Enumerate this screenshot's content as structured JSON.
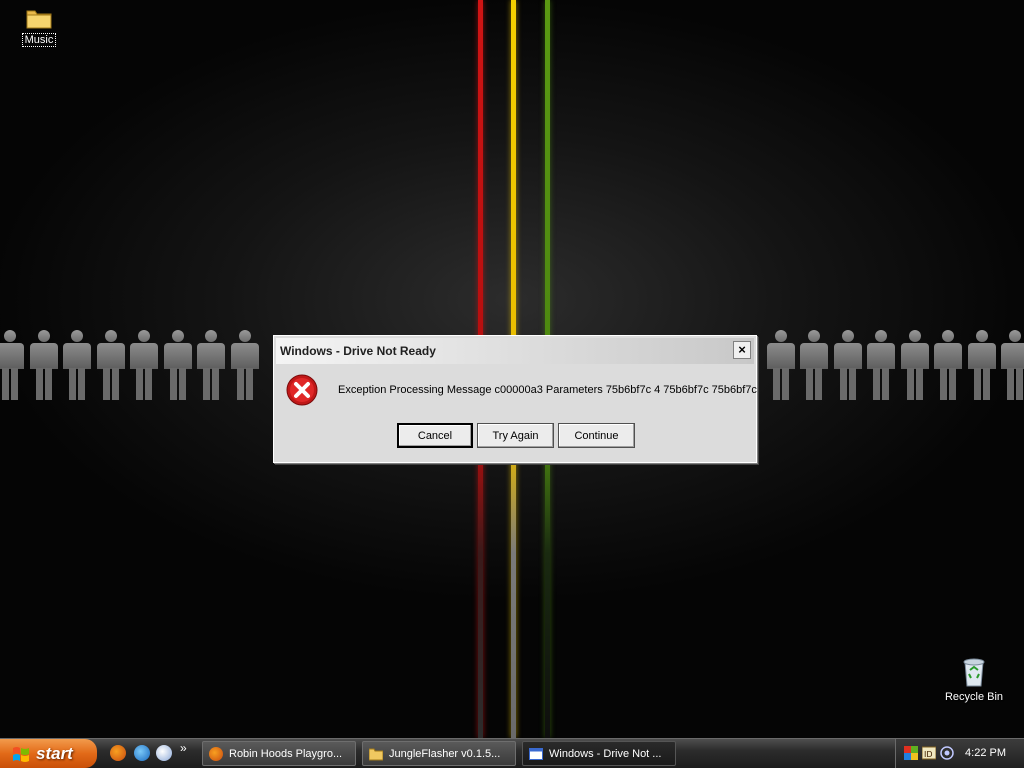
{
  "desktop": {
    "icons": [
      {
        "label": "Music",
        "icon": "folder-icon"
      },
      {
        "label": "Recycle Bin",
        "icon": "recycle-bin-icon"
      }
    ]
  },
  "dialog": {
    "title": "Windows - Drive Not Ready",
    "close_label": "×",
    "icon": "error-icon",
    "message": "Exception Processing Message c00000a3 Parameters 75b6bf7c 4 75b6bf7c 75b6bf7c",
    "buttons": {
      "cancel": "Cancel",
      "try_again": "Try Again",
      "continue": "Continue"
    }
  },
  "taskbar": {
    "start_label": "start",
    "quick_launch": [
      "firefox-icon",
      "internet-explorer-icon",
      "media-player-icon"
    ],
    "quick_launch_more": "»",
    "tasks": [
      {
        "label": "Robin Hoods Playgro...",
        "icon": "firefox-icon"
      },
      {
        "label": "JungleFlasher v0.1.5...",
        "icon": "folder-icon"
      },
      {
        "label": "Windows - Drive Not ...",
        "icon": "window-icon"
      }
    ],
    "tray_icons": [
      "security-center-icon",
      "id-icon",
      "network-icon"
    ],
    "clock": "4:22 PM"
  },
  "colors": {
    "stripe_red": "#d01414",
    "stripe_yellow": "#f4d000",
    "stripe_green": "#5a9a12",
    "start_orange": "#e26a18"
  }
}
